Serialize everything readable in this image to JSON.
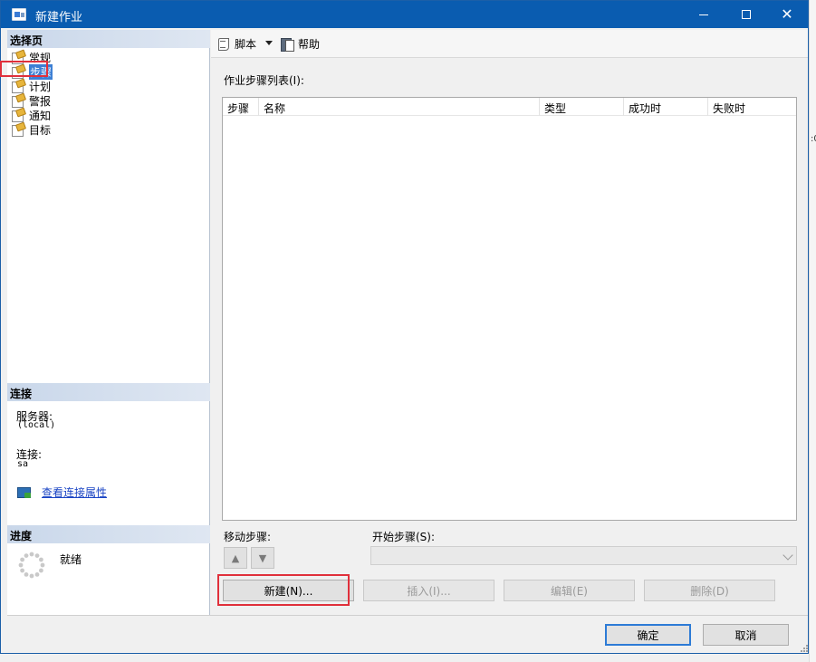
{
  "window": {
    "title": "新建作业"
  },
  "left_panel": {
    "select_page_header": "选择页",
    "pages": [
      {
        "label": "常规",
        "selected": false
      },
      {
        "label": "步骤",
        "selected": true
      },
      {
        "label": "计划",
        "selected": false
      },
      {
        "label": "警报",
        "selected": false
      },
      {
        "label": "通知",
        "selected": false
      },
      {
        "label": "目标",
        "selected": false
      }
    ],
    "connection_header": "连接",
    "server_label": "服务器:",
    "server_value": "(local)",
    "connection_label": "连接:",
    "connection_value": "sa",
    "view_connection_link": "查看连接属性",
    "progress_header": "进度",
    "progress_status": "就绪"
  },
  "toolbar": {
    "script_label": "脚本",
    "help_label": "帮助"
  },
  "steps": {
    "list_label": "作业步骤列表(I):",
    "columns": [
      "步骤",
      "名称",
      "类型",
      "成功时",
      "失败时"
    ],
    "rows": [],
    "move_label": "移动步骤:",
    "start_label": "开始步骤(S):",
    "start_value": ""
  },
  "actions": {
    "new_label": "新建(N)...",
    "insert_label": "插入(I)...",
    "edit_label": "编辑(E)",
    "delete_label": "删除(D)"
  },
  "dialog": {
    "ok_label": "确定",
    "cancel_label": "取消"
  },
  "background": {
    "right_fragment": ":0",
    "left_fragment": "a"
  },
  "colors": {
    "titlebar": "#0a5cb0",
    "selection": "#3c7fd4",
    "highlight_box": "#e0303b",
    "link": "#1a44c4"
  }
}
